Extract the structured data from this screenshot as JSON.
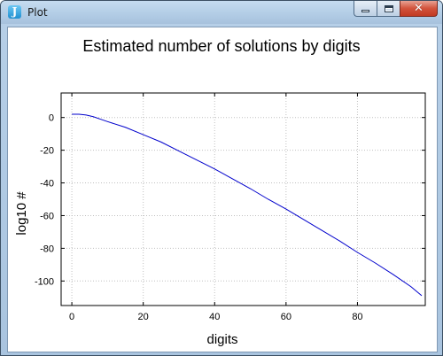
{
  "window": {
    "title": "Plot",
    "icon": "J"
  },
  "chart_data": {
    "type": "line",
    "title": "Estimated number of solutions by digits",
    "xlabel": "digits",
    "ylabel": "log10 #",
    "xlim": [
      -3,
      99
    ],
    "ylim": [
      -115,
      15
    ],
    "xticks": [
      0,
      20,
      40,
      60,
      80
    ],
    "yticks": [
      0,
      -20,
      -40,
      -60,
      -80,
      -100
    ],
    "grid": true,
    "series": [
      {
        "color": "#0000cc",
        "x": [
          0,
          2,
          4,
          6,
          8,
          10,
          15,
          20,
          25,
          30,
          35,
          40,
          45,
          50,
          55,
          60,
          65,
          70,
          75,
          80,
          85,
          90,
          95,
          98
        ],
        "y": [
          2,
          2,
          1.5,
          0.5,
          -1,
          -2.5,
          -6,
          -10.5,
          -15,
          -20.5,
          -26,
          -31.5,
          -37.5,
          -43.5,
          -50,
          -56,
          -62.5,
          -69,
          -75.5,
          -82.5,
          -89,
          -96,
          -103.5,
          -109
        ]
      }
    ]
  }
}
